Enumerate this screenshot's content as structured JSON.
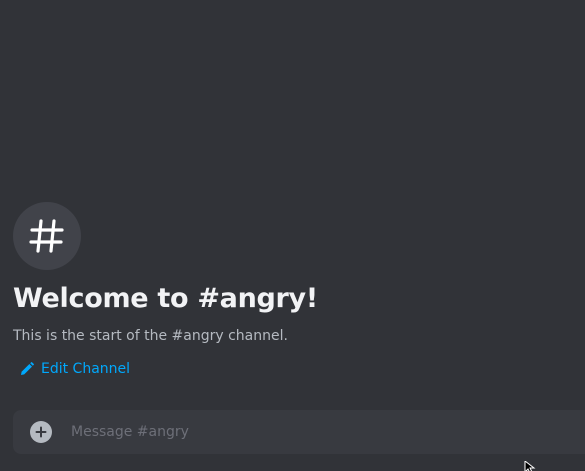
{
  "channel": {
    "icon": "hash-icon",
    "welcome_title": "Welcome to #angry!",
    "description": "This is the start of the #angry channel."
  },
  "edit_channel": {
    "icon": "pencil-icon",
    "label": "Edit Channel"
  },
  "composer": {
    "add_icon": "plus-circle-icon",
    "placeholder": "Message #angry",
    "value": ""
  },
  "colors": {
    "background": "#313338",
    "link": "#00a8fc",
    "composer_bg": "#383a40"
  }
}
